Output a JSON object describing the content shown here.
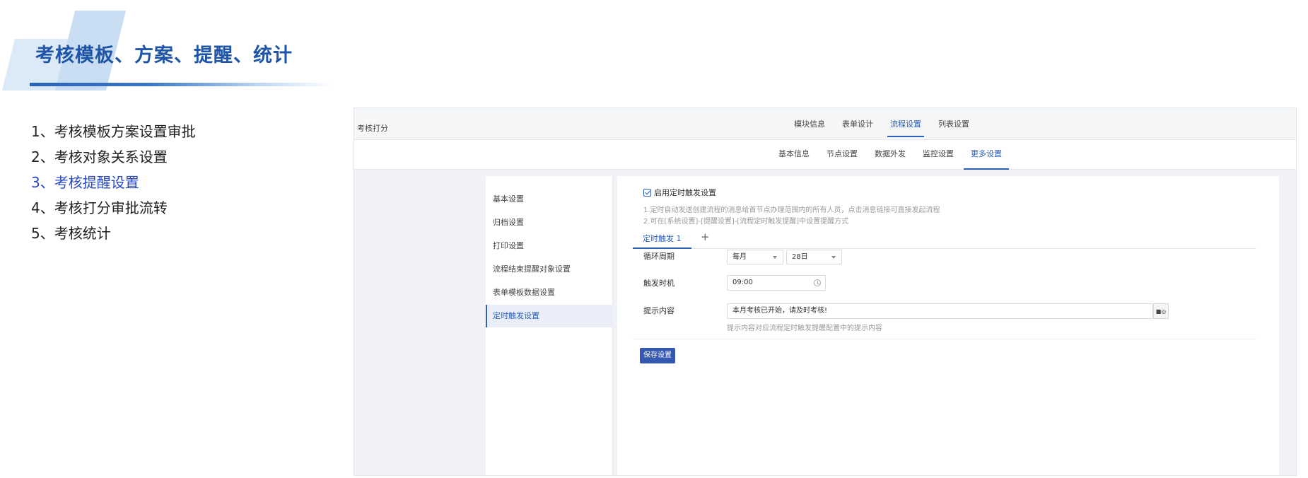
{
  "slide": {
    "title": "考核模板、方案、提醒、统计",
    "steps": [
      "1、考核模板方案设置审批",
      "2、考核对象关系设置",
      "3、考核提醒设置",
      "4、考核打分审批流转",
      "5、考核统计"
    ],
    "active_step_index": 2
  },
  "app": {
    "name": "考核打分",
    "top_tabs": [
      "模块信息",
      "表单设计",
      "流程设置",
      "列表设置"
    ],
    "top_tab_active": "流程设置",
    "sub_tabs": [
      "基本信息",
      "节点设置",
      "数据外发",
      "监控设置",
      "更多设置"
    ],
    "sub_tab_active": "更多设置",
    "side_menu": [
      "基本设置",
      "归档设置",
      "打印设置",
      "流程结束提醒对象设置",
      "表单模板数据设置",
      "定时触发设置"
    ],
    "side_menu_active": "定时触发设置"
  },
  "panel": {
    "enable_label": "启用定时触发设置",
    "enable_checked": true,
    "hint_1": "1.定时自动发送创建流程的消息给首节点办理范围内的所有人员，点击消息链接可直接发起流程",
    "hint_2": "2.可在[系统设置]-[提醒设置]-[流程定时触发提醒]中设置提醒方式",
    "inner_tab": "定时触发 1",
    "add_tab_symbol": "+",
    "cycle_label": "循环周期",
    "cycle_value": "每月",
    "day_value": "28日",
    "time_label": "触发时机",
    "time_value": "09:00",
    "content_label": "提示内容",
    "content_value": "本月考核已开始，请及时考核!",
    "content_hint": "提示内容对应流程定时触发提醒配置中的提示内容",
    "content_btn_label": "■◎",
    "save_label": "保存设置"
  },
  "colors": {
    "title_blue": "#1f55a8",
    "accent_blue": "#2b5fb8",
    "active_step": "#2848c8",
    "save_button": "#3457b0"
  }
}
